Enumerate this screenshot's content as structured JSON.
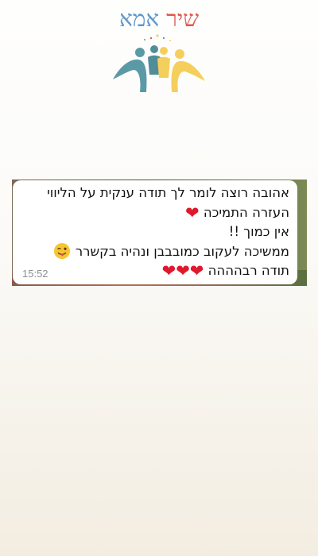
{
  "logo": {
    "word_1": "שיר",
    "word_2": "אמא",
    "figures_icon": "family-figures-logo-icon",
    "colors": {
      "teal": "#5a9aa6",
      "yellow": "#f5cf5c",
      "red": "#e2574c",
      "blue": "#5f97cc"
    }
  },
  "message": {
    "lines": [
      "אהובה רוצה לומר לך תודה ענקית על הליווי",
      "העזרה התמיכה",
      "אין כמוך !!",
      "ממשיכה לעקוב כמובבבן ונהיה בקשרר",
      "תודה רבהההה"
    ],
    "emoji": {
      "heart": "❤",
      "heart_color": "#e0182d",
      "wink_icon": "winking-face-tongue-icon"
    },
    "time": "15:52"
  }
}
